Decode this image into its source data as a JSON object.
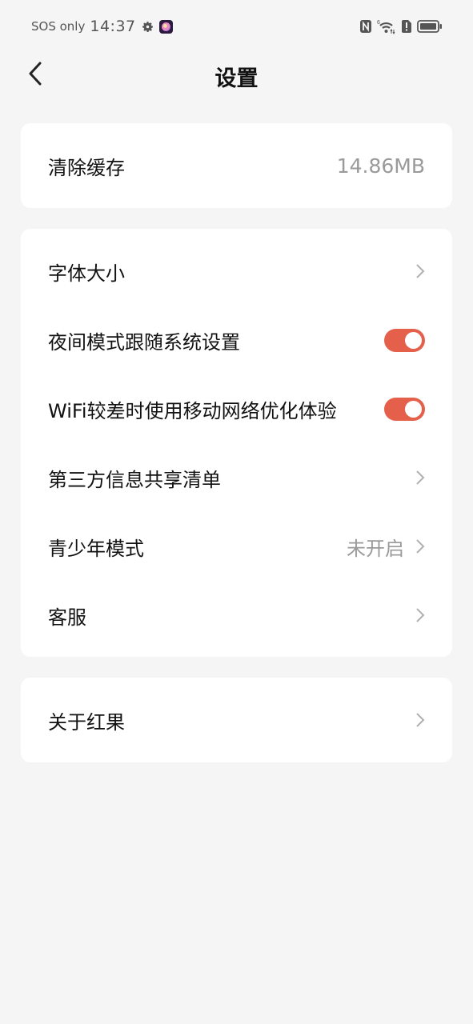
{
  "status_bar": {
    "carrier": "SOS only",
    "time": "14:37",
    "icons": [
      "gear-icon",
      "app-notification-icon",
      "nfc-icon",
      "wifi-6-icon",
      "sim-alert-icon",
      "battery-icon"
    ],
    "wifi_badge": "6"
  },
  "header": {
    "back_icon": "chevron-left-icon",
    "title": "设置"
  },
  "cache_card": {
    "label": "清除缓存",
    "value": "14.86MB"
  },
  "settings_card": {
    "items": [
      {
        "label": "字体大小",
        "type": "link",
        "icon": "chevron-right-icon"
      },
      {
        "label": "夜间模式跟随系统设置",
        "type": "toggle",
        "enabled": true
      },
      {
        "label": "WiFi较差时使用移动网络优化体验",
        "type": "toggle",
        "enabled": true
      },
      {
        "label": "第三方信息共享清单",
        "type": "link",
        "icon": "chevron-right-icon"
      },
      {
        "label": "青少年模式",
        "type": "link",
        "value": "未开启",
        "icon": "chevron-right-icon"
      },
      {
        "label": "客服",
        "type": "link",
        "icon": "chevron-right-icon"
      }
    ]
  },
  "about_card": {
    "label": "关于红果",
    "icon": "chevron-right-icon"
  },
  "colors": {
    "accent": "#e4604a",
    "background": "#f5f5f5",
    "card": "#ffffff",
    "secondary_text": "#9a9a9a"
  }
}
